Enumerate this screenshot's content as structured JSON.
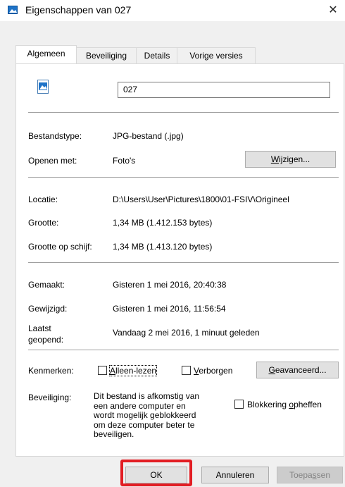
{
  "window": {
    "title": "Eigenschappen van 027",
    "close_glyph": "✕"
  },
  "tabs": [
    {
      "label": "Algemeen",
      "active": true
    },
    {
      "label": "Beveiliging",
      "active": false
    },
    {
      "label": "Details",
      "active": false
    },
    {
      "label": "Vorige versies",
      "active": false
    }
  ],
  "general": {
    "file_name": "027",
    "file_type_label": "Bestandstype:",
    "file_type_value": "JPG-bestand (.jpg)",
    "opens_with_label": "Openen met:",
    "opens_with_value": "Foto's",
    "change_button": {
      "pre": "",
      "accel": "W",
      "post": "ijzigen..."
    },
    "location_label": "Locatie:",
    "location_value": "D:\\Users\\User\\Pictures\\1800\\01-FSIV\\Origineel",
    "size_label": "Grootte:",
    "size_value": "1,34 MB (1.412.153 bytes)",
    "size_on_disk_label": "Grootte op schijf:",
    "size_on_disk_value": "1,34 MB (1.413.120 bytes)",
    "created_label": "Gemaakt:",
    "created_value": "Gisteren 1 mei 2016, 20:40:38",
    "modified_label": "Gewijzigd:",
    "modified_value": "Gisteren 1 mei 2016, 11:56:54",
    "accessed_label_line1": "Laatst",
    "accessed_label_line2": "geopend:",
    "accessed_value": "Vandaag 2 mei 2016, 1 minuut geleden",
    "attributes_label": "Kenmerken:",
    "readonly": {
      "pre": "",
      "accel": "A",
      "post": "lleen-lezen",
      "checked": false
    },
    "hidden": {
      "pre": "",
      "accel": "V",
      "post": "erborgen",
      "checked": false
    },
    "advanced_button": {
      "pre": "",
      "accel": "G",
      "post": "eavanceerd..."
    },
    "security_label": "Beveiliging:",
    "security_text": [
      "Dit bestand is afkomstig van",
      "een andere computer en",
      "wordt mogelijk geblokkeerd",
      "om deze computer beter te",
      "beveiligen."
    ],
    "unblock": {
      "pre": "Blokkering ",
      "accel": "o",
      "post": "pheffen",
      "checked": false
    }
  },
  "footer": {
    "ok_label": "OK",
    "cancel_label": "Annuleren",
    "apply": {
      "pre": "Toepa",
      "accel": "s",
      "post": "sen"
    }
  },
  "colors": {
    "highlight": "#e21d23",
    "separator": "#a0a0a0"
  }
}
